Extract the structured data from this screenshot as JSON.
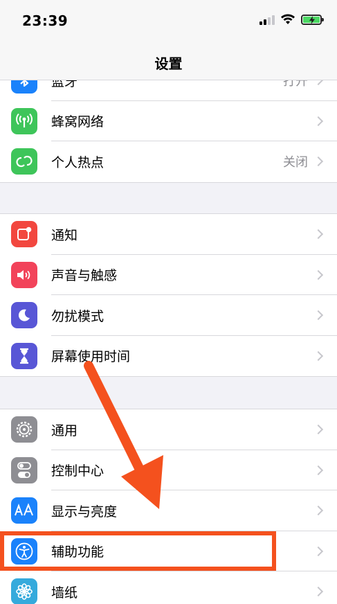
{
  "status_bar": {
    "time": "23:39"
  },
  "nav": {
    "title": "设置"
  },
  "groups": [
    {
      "rows": [
        {
          "label": "蓝牙",
          "value": "打开",
          "icon": "bluetooth-icon",
          "color": "#1a82fb"
        },
        {
          "label": "蜂窝网络",
          "value": "",
          "icon": "antenna-icon",
          "color": "#3ec55a"
        },
        {
          "label": "个人热点",
          "value": "关闭",
          "icon": "hotspot-icon",
          "color": "#3ec55a"
        }
      ]
    },
    {
      "rows": [
        {
          "label": "通知",
          "value": "",
          "icon": "notification-icon",
          "color": "#f2473f"
        },
        {
          "label": "声音与触感",
          "value": "",
          "icon": "speaker-icon",
          "color": "#f2435a"
        },
        {
          "label": "勿扰模式",
          "value": "",
          "icon": "moon-icon",
          "color": "#5856d6"
        },
        {
          "label": "屏幕使用时间",
          "value": "",
          "icon": "hourglass-icon",
          "color": "#5856d6"
        }
      ]
    },
    {
      "rows": [
        {
          "label": "通用",
          "value": "",
          "icon": "gear-icon",
          "color": "#8e8e93"
        },
        {
          "label": "控制中心",
          "value": "",
          "icon": "toggles-icon",
          "color": "#8e8e93"
        },
        {
          "label": "显示与亮度",
          "value": "",
          "icon": "text-size-icon",
          "color": "#1a82fb"
        },
        {
          "label": "辅助功能",
          "value": "",
          "icon": "accessibility-icon",
          "color": "#1a82fb"
        },
        {
          "label": "墙纸",
          "value": "",
          "icon": "flower-icon",
          "color": "#35aadc"
        }
      ]
    }
  ],
  "annotation": {
    "arrow_color": "#f4511e",
    "highlight_color": "#f4511e"
  }
}
